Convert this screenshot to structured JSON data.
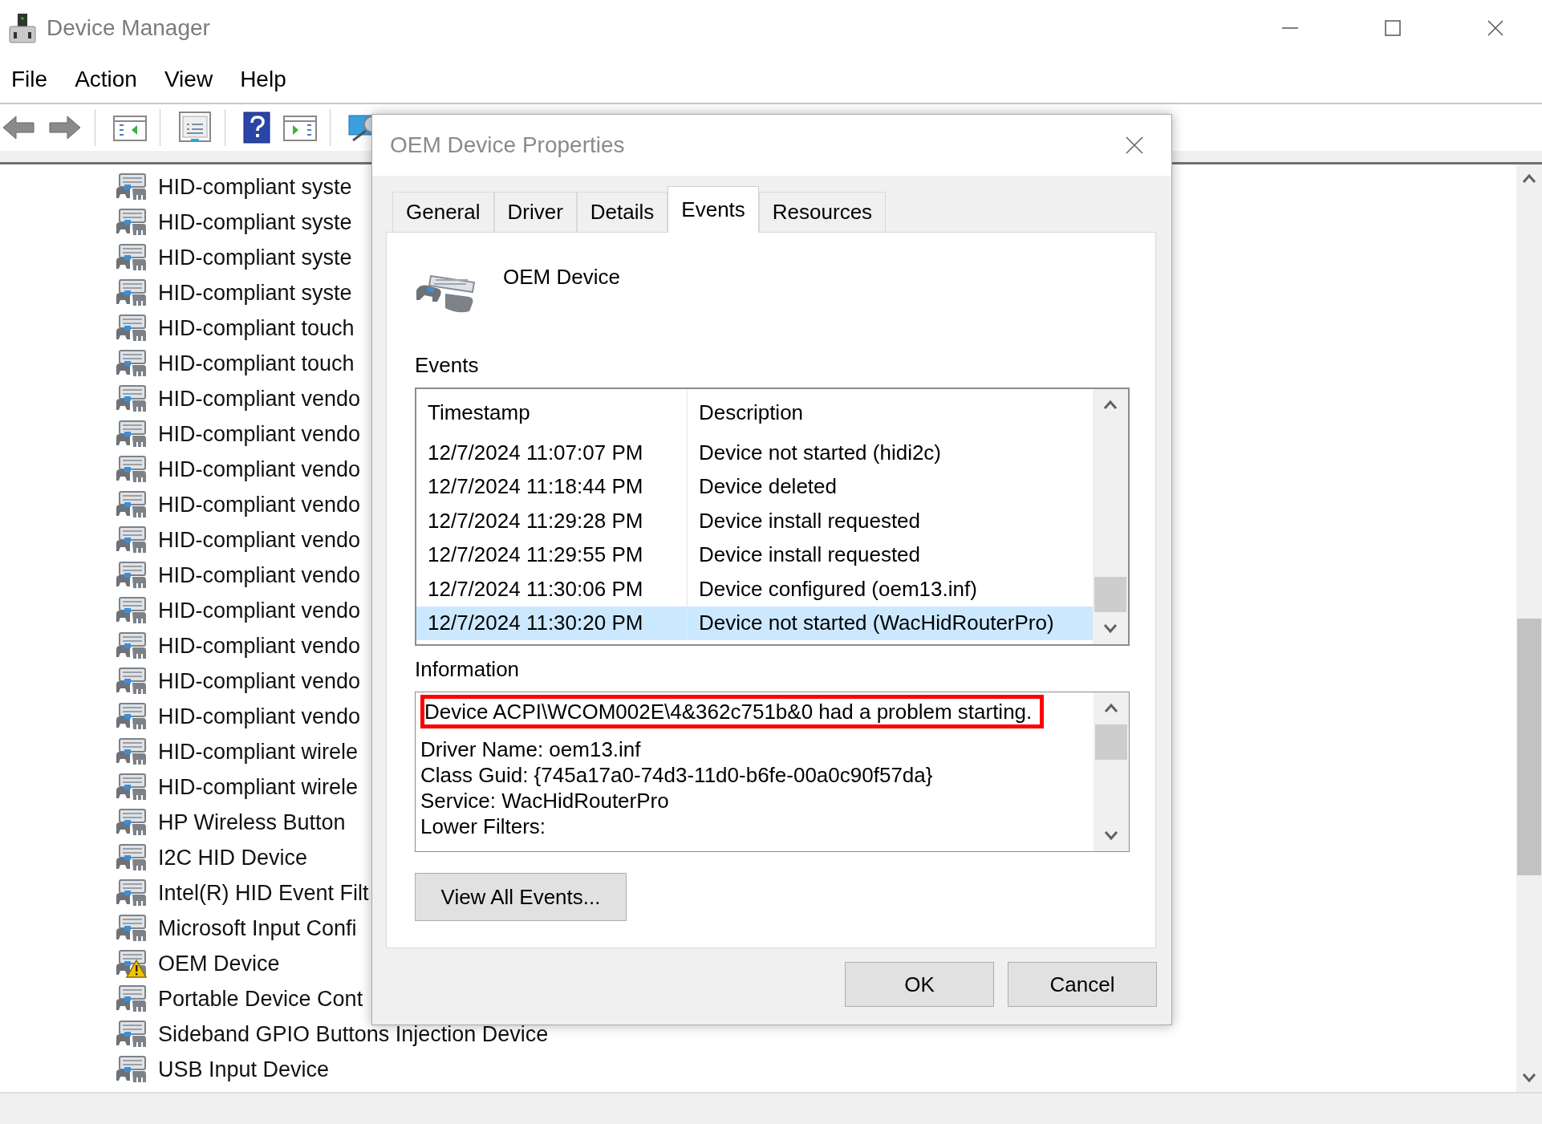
{
  "window": {
    "title": "Device Manager"
  },
  "menu": [
    "File",
    "Action",
    "View",
    "Help"
  ],
  "tree": {
    "items": [
      {
        "label": "HID-compliant syste",
        "warning": false
      },
      {
        "label": "HID-compliant syste",
        "warning": false
      },
      {
        "label": "HID-compliant syste",
        "warning": false
      },
      {
        "label": "HID-compliant syste",
        "warning": false
      },
      {
        "label": "HID-compliant touch",
        "warning": false
      },
      {
        "label": "HID-compliant touch",
        "warning": false
      },
      {
        "label": "HID-compliant vendo",
        "warning": false
      },
      {
        "label": "HID-compliant vendo",
        "warning": false
      },
      {
        "label": "HID-compliant vendo",
        "warning": false
      },
      {
        "label": "HID-compliant vendo",
        "warning": false
      },
      {
        "label": "HID-compliant vendo",
        "warning": false
      },
      {
        "label": "HID-compliant vendo",
        "warning": false
      },
      {
        "label": "HID-compliant vendo",
        "warning": false
      },
      {
        "label": "HID-compliant vendo",
        "warning": false
      },
      {
        "label": "HID-compliant vendo",
        "warning": false
      },
      {
        "label": "HID-compliant vendo",
        "warning": false
      },
      {
        "label": "HID-compliant wirele",
        "warning": false
      },
      {
        "label": "HID-compliant wirele",
        "warning": false
      },
      {
        "label": "HP Wireless Button",
        "warning": false
      },
      {
        "label": "I2C HID Device",
        "warning": false
      },
      {
        "label": "Intel(R) HID Event Filt",
        "warning": false
      },
      {
        "label": "Microsoft Input Confi",
        "warning": false
      },
      {
        "label": "OEM Device",
        "warning": true
      },
      {
        "label": "Portable Device Cont",
        "warning": false
      },
      {
        "label": "Sideband GPIO Buttons Injection Device",
        "warning": false
      },
      {
        "label": "USB Input Device",
        "warning": false
      }
    ]
  },
  "dialog": {
    "title": "OEM Device Properties",
    "tabs": [
      {
        "label": "General",
        "selected": false
      },
      {
        "label": "Driver",
        "selected": false
      },
      {
        "label": "Details",
        "selected": false
      },
      {
        "label": "Events",
        "selected": true
      },
      {
        "label": "Resources",
        "selected": false
      }
    ],
    "device_name": "OEM Device",
    "events_label": "Events",
    "events_table": {
      "columns": [
        "Timestamp",
        "Description"
      ],
      "rows": [
        {
          "timestamp": "12/7/2024 11:07:07 PM",
          "description": "Device not started (hidi2c)",
          "selected": false
        },
        {
          "timestamp": "12/7/2024 11:18:44 PM",
          "description": "Device deleted",
          "selected": false
        },
        {
          "timestamp": "12/7/2024 11:29:28 PM",
          "description": "Device install requested",
          "selected": false
        },
        {
          "timestamp": "12/7/2024 11:29:55 PM",
          "description": "Device install requested",
          "selected": false
        },
        {
          "timestamp": "12/7/2024 11:30:06 PM",
          "description": "Device configured (oem13.inf)",
          "selected": false
        },
        {
          "timestamp": "12/7/2024 11:30:20 PM",
          "description": "Device not started (WacHidRouterPro)",
          "selected": true
        }
      ]
    },
    "information_label": "Information",
    "information": {
      "message": {
        "text": "Device ACPI\\WCOM002E\\4&362c751b&0 had a problem starting.",
        "highlighted": true
      },
      "details": [
        "Driver Name: oem13.inf",
        "Class Guid: {745a17a0-74d3-11d0-b6fe-00a0c90f57da}",
        "Service: WacHidRouterPro",
        "Lower Filters:"
      ]
    },
    "view_all_button": "View All Events...",
    "buttons": [
      "OK",
      "Cancel"
    ]
  }
}
